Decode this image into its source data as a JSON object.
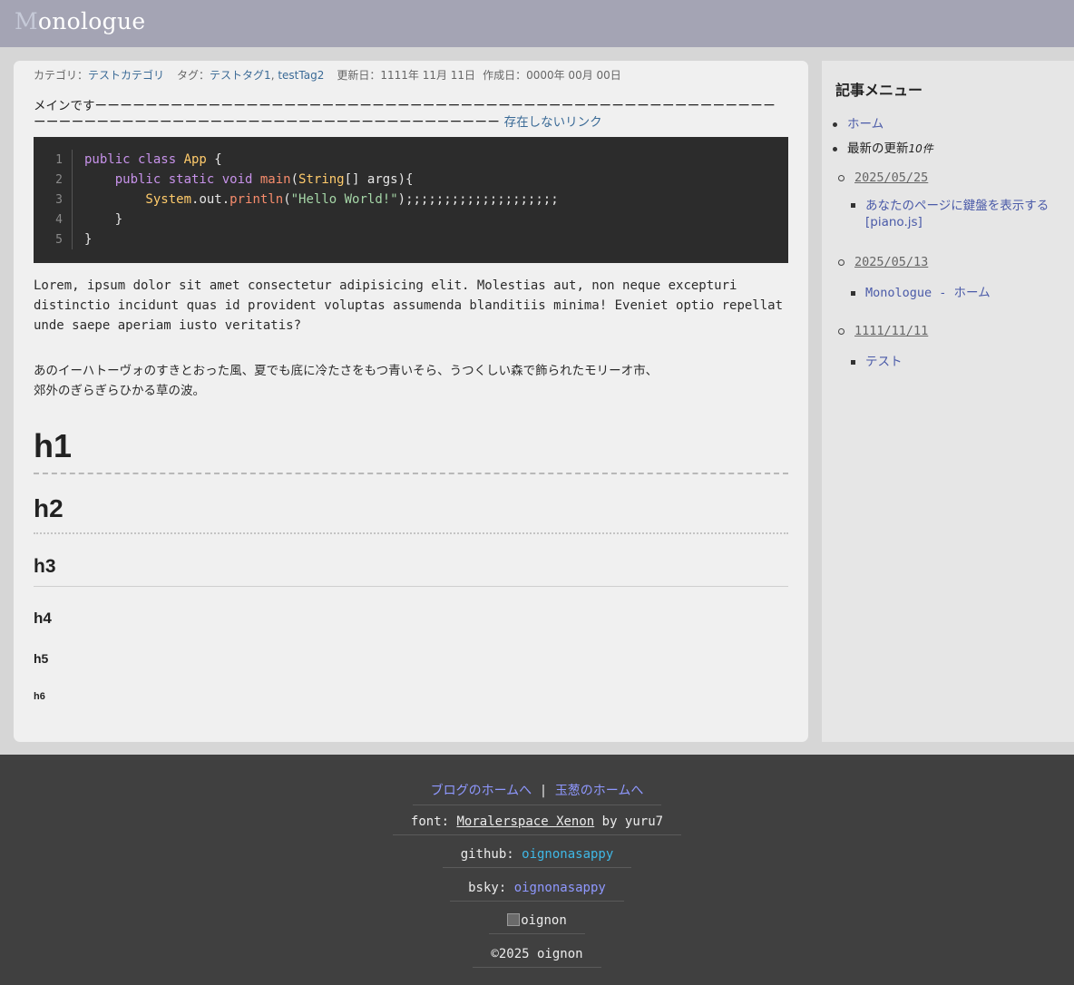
{
  "header": {
    "title_first": "M",
    "title_rest": "onologue"
  },
  "meta": {
    "category_label": "カテゴリ：",
    "category": "テストカテゴリ",
    "tag_label": "タグ：",
    "tag1": "テストタグ1",
    "tag_sep": ", ",
    "tag2": "testTag2",
    "updated_label": "更新日：",
    "updated": "1111年 11月 11日",
    "created_label": "作成日：",
    "created": "0000年 00月 00日"
  },
  "lead": {
    "text": "メインです",
    "dashes": "ーーーーーーーーーーーーーーーーーーーーーーーーーーーーーーーーーーーーーーーーーーーーーーーーーーーーーーーーーーーーーーーーーーーーーーーーーーーーーーーーーーーーーーーーーーー",
    "link": "存在しないリンク"
  },
  "code": {
    "line_numbers": [
      "1",
      "2",
      "3",
      "4",
      "5"
    ]
  },
  "body": {
    "lorem": "Lorem, ipsum dolor sit amet consectetur adipisicing elit. Molestias aut, non neque excepturi distinctio incidunt quas id provident voluptas assumenda blanditiis minima! Eveniet optio repellat unde saepe aperiam iusto veritatis?",
    "jp_line1": "あのイーハトーヴォのすきとおった風、夏でも底に冷たさをもつ青いそら、うつくしい森で飾られたモリーオ市、",
    "jp_line2": "郊外のぎらぎらひかる草の波。"
  },
  "headings": {
    "h1": "h1",
    "h2": "h2",
    "h3": "h3",
    "h4": "h4",
    "h5": "h5",
    "h6": "h6"
  },
  "sidebar": {
    "title": "記事メニュー",
    "home": "ホーム",
    "recent_label": "最新の更新",
    "recent_count": "10件",
    "groups": [
      {
        "date": "2025/05/25",
        "item": "あなたのページに鍵盤を表示する[piano.js]"
      },
      {
        "date": "2025/05/13",
        "item": "Monologue - ホーム"
      },
      {
        "date": "1111/11/11",
        "item": "テスト"
      }
    ]
  },
  "footer": {
    "blog_home": "ブログのホームへ",
    "sep": "|",
    "onion_home": "玉葱のホームへ",
    "font_label": "font: ",
    "font_name": "Moralerspace Xenon",
    "font_by": " by yuru7",
    "github_label": "github: ",
    "github_user": "oignonasappy",
    "bsky_label": "bsky: ",
    "bsky_user": "oignonasappy",
    "img_alt": "oignon",
    "copyright": "©2025 oignon"
  }
}
